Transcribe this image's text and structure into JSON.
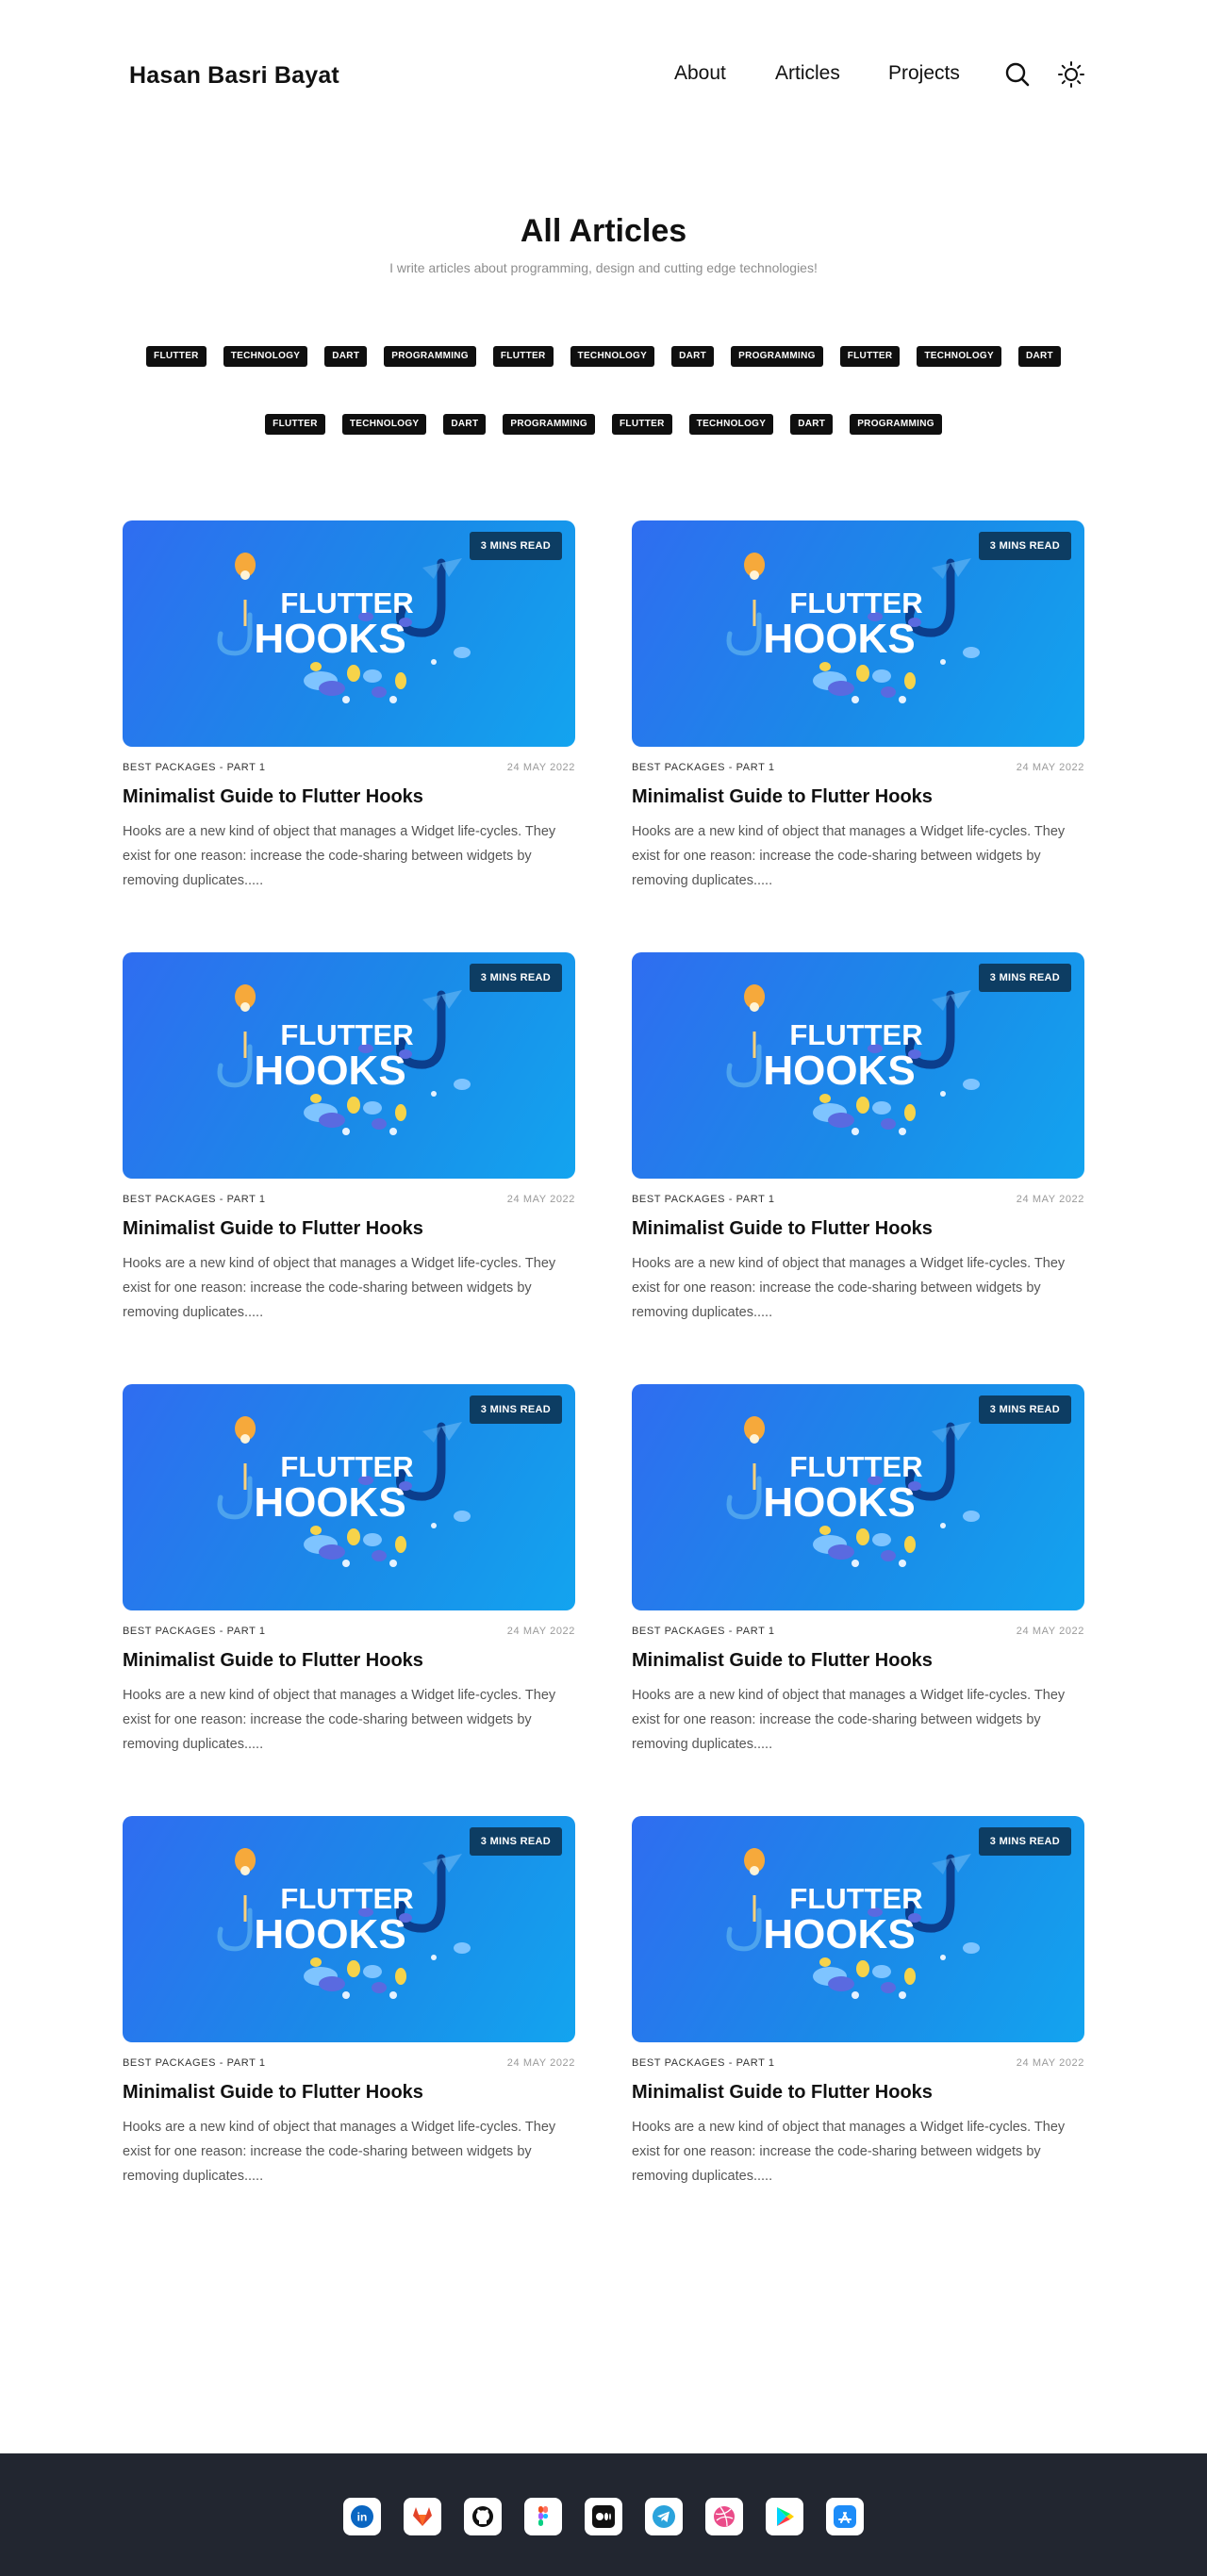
{
  "header": {
    "brand": "Hasan Basri Bayat",
    "nav": [
      {
        "label": "About"
      },
      {
        "label": "Articles"
      },
      {
        "label": "Projects"
      }
    ]
  },
  "hero": {
    "title": "All Articles",
    "subtitle": "I write articles about programming, design and cutting edge technologies!"
  },
  "tags": [
    "FLUTTER",
    "TECHNOLOGY",
    "DART",
    "PROGRAMMING",
    "FLUTTER",
    "TECHNOLOGY",
    "DART",
    "PROGRAMMING",
    "FLUTTER",
    "TECHNOLOGY",
    "DART",
    "FLUTTER",
    "TECHNOLOGY",
    "DART",
    "PROGRAMMING",
    "FLUTTER",
    "TECHNOLOGY",
    "DART",
    "PROGRAMMING"
  ],
  "articles": [
    {
      "badge": "3 MINS READ",
      "image_text_top": "FLUTTER",
      "image_text_bottom": "HOOKS",
      "series": "BEST PACKAGES - PART 1",
      "date": "24 MAY 2022",
      "title": "Minimalist Guide to Flutter Hooks",
      "excerpt": "Hooks are a new kind of object that manages a Widget life-cycles. They exist for one reason: increase the code-sharing between widgets by removing duplicates....."
    },
    {
      "badge": "3 MINS READ",
      "image_text_top": "FLUTTER",
      "image_text_bottom": "HOOKS",
      "series": "BEST PACKAGES - PART 1",
      "date": "24 MAY 2022",
      "title": "Minimalist Guide to Flutter Hooks",
      "excerpt": "Hooks are a new kind of object that manages a Widget life-cycles. They exist for one reason: increase the code-sharing between widgets by removing duplicates....."
    },
    {
      "badge": "3 MINS READ",
      "image_text_top": "FLUTTER",
      "image_text_bottom": "HOOKS",
      "series": "BEST PACKAGES - PART 1",
      "date": "24 MAY 2022",
      "title": "Minimalist Guide to Flutter Hooks",
      "excerpt": "Hooks are a new kind of object that manages a Widget life-cycles. They exist for one reason: increase the code-sharing between widgets by removing duplicates....."
    },
    {
      "badge": "3 MINS READ",
      "image_text_top": "FLUTTER",
      "image_text_bottom": "HOOKS",
      "series": "BEST PACKAGES - PART 1",
      "date": "24 MAY 2022",
      "title": "Minimalist Guide to Flutter Hooks",
      "excerpt": "Hooks are a new kind of object that manages a Widget life-cycles. They exist for one reason: increase the code-sharing between widgets by removing duplicates....."
    },
    {
      "badge": "3 MINS READ",
      "image_text_top": "FLUTTER",
      "image_text_bottom": "HOOKS",
      "series": "BEST PACKAGES - PART 1",
      "date": "24 MAY 2022",
      "title": "Minimalist Guide to Flutter Hooks",
      "excerpt": "Hooks are a new kind of object that manages a Widget life-cycles. They exist for one reason: increase the code-sharing between widgets by removing duplicates....."
    },
    {
      "badge": "3 MINS READ",
      "image_text_top": "FLUTTER",
      "image_text_bottom": "HOOKS",
      "series": "BEST PACKAGES - PART 1",
      "date": "24 MAY 2022",
      "title": "Minimalist Guide to Flutter Hooks",
      "excerpt": "Hooks are a new kind of object that manages a Widget life-cycles. They exist for one reason: increase the code-sharing between widgets by removing duplicates....."
    },
    {
      "badge": "3 MINS READ",
      "image_text_top": "FLUTTER",
      "image_text_bottom": "HOOKS",
      "series": "BEST PACKAGES - PART 1",
      "date": "24 MAY 2022",
      "title": "Minimalist Guide to Flutter Hooks",
      "excerpt": "Hooks are a new kind of object that manages a Widget life-cycles. They exist for one reason: increase the code-sharing between widgets by removing duplicates....."
    },
    {
      "badge": "3 MINS READ",
      "image_text_top": "FLUTTER",
      "image_text_bottom": "HOOKS",
      "series": "BEST PACKAGES - PART 1",
      "date": "24 MAY 2022",
      "title": "Minimalist Guide to Flutter Hooks",
      "excerpt": "Hooks are a new kind of object that manages a Widget life-cycles. They exist for one reason: increase the code-sharing between widgets by removing duplicates....."
    }
  ],
  "footer": {
    "social_icons": [
      "linkedin-icon",
      "gitlab-icon",
      "github-icon",
      "figma-icon",
      "medium-icon",
      "telegram-icon",
      "dribbble-icon",
      "google-play-icon",
      "app-store-icon"
    ]
  },
  "colors": {
    "tag_bg": "#0f0f0f",
    "badge_bg": "#0d3d63",
    "thumb_gradient_start": "#2f6df0",
    "thumb_gradient_end": "#13a4ef",
    "footer_bg": "#222630"
  }
}
